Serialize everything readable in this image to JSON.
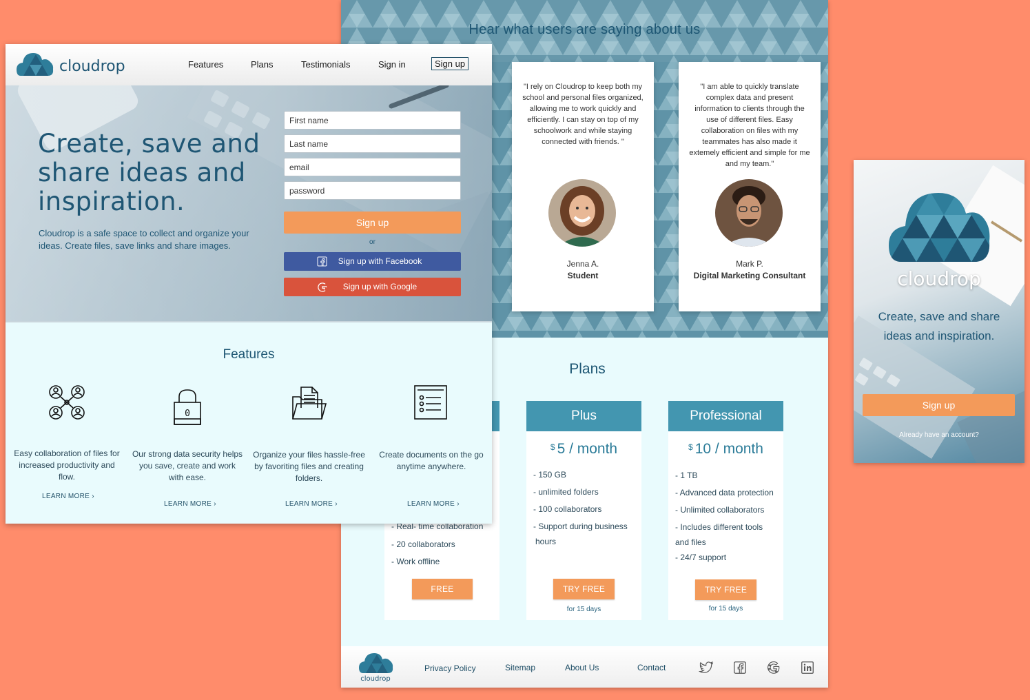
{
  "testimonials": {
    "title": "Hear what users are saying about us",
    "items": [
      {
        "quote": "\"I rely on Cloudrop to keep both my school and personal files organized, allowing me to work quickly and efficiently. I can stay on top of my schoolwork and while staying connected with friends. \"",
        "name": "Jenna A.",
        "role": "Student"
      },
      {
        "quote": "\"I am able to quickly translate complex data and present information to clients through the use of different files. Easy collaboration on files with my teammates has also made it extemely efficient and simple for me and my team.\"",
        "name": "Mark P.",
        "role": "Digital Marketing Consultant"
      }
    ]
  },
  "plans": {
    "title": "Plans",
    "free": {
      "features": [
        "- Real- time collaboration",
        "- 20 collaborators",
        "- Work offline"
      ],
      "button": "FREE"
    },
    "plus": {
      "name": "Plus",
      "currency": "$",
      "price": "5 / month",
      "features": [
        "- 150 GB",
        "- unlimited folders",
        "- 100 collaborators",
        "- Support during business",
        "hours"
      ],
      "button": "TRY FREE",
      "note": "for 15 days"
    },
    "professional": {
      "name": "Professional",
      "currency": "$",
      "price": "10 / month",
      "features": [
        "- 1 TB",
        "- Advanced data protection",
        "- Unlimited collaborators",
        "- Includes different tools",
        "and files",
        "- 24/7 support"
      ],
      "button": "TRY FREE",
      "note": "for 15 days"
    }
  },
  "footer": {
    "brand": "cloudrop",
    "links": [
      "Privacy Policy",
      "Sitemap",
      "About Us",
      "Contact"
    ],
    "social_icons": [
      "twitter-icon",
      "facebook-icon",
      "google-icon",
      "linkedin-icon"
    ]
  },
  "nav": {
    "brand": "cloudrop",
    "links": [
      "Features",
      "Plans",
      "Testimonials",
      "Sign in"
    ],
    "signup": "Sign up"
  },
  "hero": {
    "title": "Create, save and share ideas and inspiration.",
    "subtitle": "Cloudrop is a safe space to collect and organize your ideas. Create files, save links and share images.",
    "form": {
      "first_name": "First name",
      "last_name": "Last name",
      "email": "email",
      "password": "password",
      "signup": "Sign up",
      "or": "or",
      "facebook": "Sign up with Facebook",
      "google": "Sign up with Google"
    }
  },
  "features": {
    "title": "Features",
    "items": [
      {
        "icon": "collaboration-icon",
        "text": "Easy collaboration of files for increased productivity and flow.",
        "link": "LEARN MORE"
      },
      {
        "icon": "lock-icon",
        "text": "Our strong data security helps you save, create and work with ease.",
        "link": "LEARN MORE"
      },
      {
        "icon": "folder-icon",
        "text": "Organize your files hassle-free by favoriting files and creating folders.",
        "link": "LEARN MORE"
      },
      {
        "icon": "checklist-icon",
        "text": "Create documents on the go anytime anywhere.",
        "link": "LEARN MORE"
      }
    ]
  },
  "mobile": {
    "brand": "cloudrop",
    "tagline": "Create, save and share ideas and inspiration.",
    "signup": "Sign up",
    "already": "Already have an account?"
  },
  "colors": {
    "accent_orange": "#f39a5a",
    "brand_blue": "#1f5674",
    "plan_header": "#4396b0",
    "facebook": "#3f5aa0",
    "google": "#d9533c",
    "background": "#ff8c6b"
  }
}
